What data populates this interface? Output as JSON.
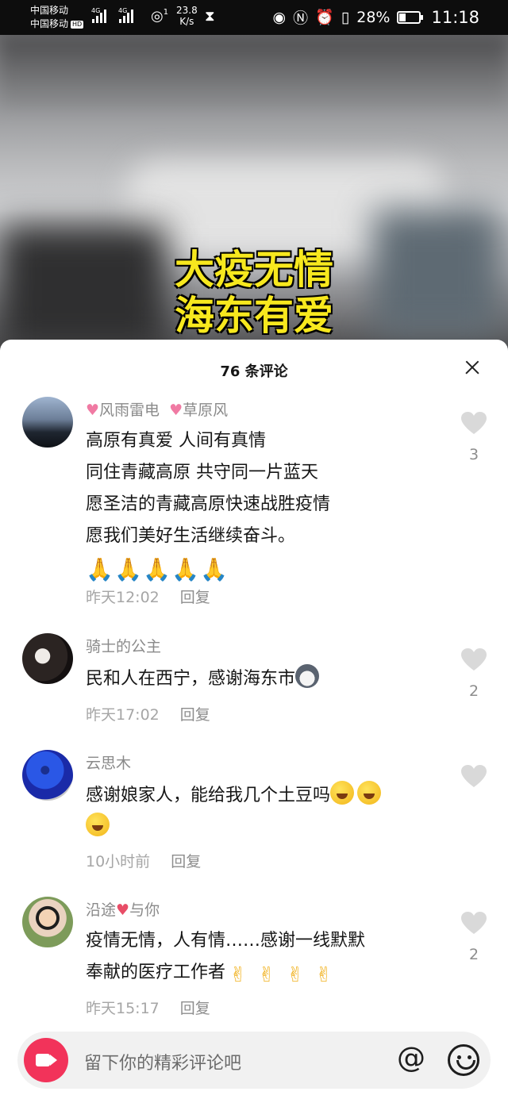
{
  "status_bar": {
    "carrier1": "中国移动",
    "carrier2": "中国移动",
    "hd_badge": "HD",
    "network1": "4G",
    "network2": "4G",
    "speed_value": "23.8",
    "speed_unit": "K/s",
    "wifi_num": "1",
    "battery_percent": "28%",
    "time": "11:18",
    "battery_level": 0.28
  },
  "video": {
    "title_line1": "大疫无情",
    "title_line2": "海东有爱"
  },
  "comments_panel": {
    "title": "76 条评论",
    "comments": [
      {
        "author": "风雨雷电",
        "author2": "草原风",
        "lines": [
          "高原有真爱  人间有真情",
          "同住青藏高原  共守同一片蓝天",
          "愿圣洁的青藏高原快速战胜疫情",
          "愿我们美好生活继续奋斗。"
        ],
        "emoji_icon": "pray-emoji",
        "time": "昨天12:02",
        "reply": "回复",
        "likes": "3"
      },
      {
        "author": "骑士的公主",
        "lines": [
          "民和人在西宁，感谢海东市"
        ],
        "emoji_icon": "dog-emoji",
        "time": "昨天17:02",
        "reply": "回复",
        "likes": "2"
      },
      {
        "author": "云思木",
        "lines": [
          "感谢娘家人，能给我几个土豆吗"
        ],
        "emoji_icon": "laughing-tears-emoji",
        "time": "10小时前",
        "reply": "回复",
        "likes": ""
      },
      {
        "author_part1": "沿途",
        "author_part2": "与你",
        "lines": [
          "疫情无情，人有情……感谢一线默默",
          "奉献的医疗工作者"
        ],
        "emoji_icon": "crossed-fingers-emoji",
        "time": "昨天15:17",
        "reply": "回复",
        "likes": "2"
      }
    ]
  },
  "input_bar": {
    "placeholder": "留下你的精彩评论吧",
    "at_symbol": "@"
  },
  "colors": {
    "title_yellow": "#f7e81e",
    "accent_red": "#f2335a",
    "heart_pink": "#f07aa3"
  }
}
